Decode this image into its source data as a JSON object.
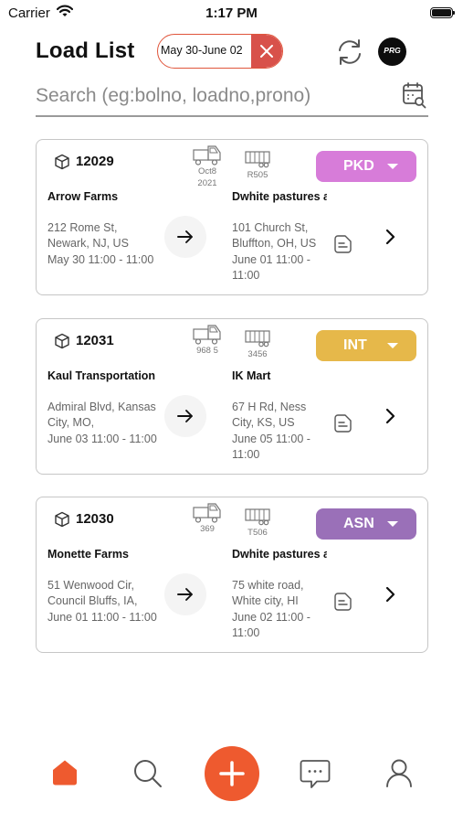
{
  "status_bar": {
    "carrier": "Carrier",
    "time": "1:17 PM"
  },
  "header": {
    "title": "Load List",
    "date_range": "May 30-June 02",
    "logo_text": "PRG"
  },
  "search": {
    "placeholder": "Search (eg:bolno, loadno,prono)",
    "value": ""
  },
  "colors": {
    "accent": "#ee5a2f",
    "pkd": "#d77cd9",
    "int": "#e6b84a",
    "asn": "#9a70b8"
  },
  "loads": [
    {
      "load_no": "12029",
      "truck": "Oct8 2021",
      "trailer": "R505",
      "status": "PKD",
      "status_color": "#d77cd9",
      "origin_name": "Arrow Farms",
      "origin_address": "212 Rome St, Newark, NJ, US",
      "origin_time": "May 30 11:00 - 11:00",
      "dest_name": "Dwhite pastures and general stor",
      "dest_address": "101 Church St, Bluffton, OH, US",
      "dest_time": "June 01 11:00 - 11:00"
    },
    {
      "load_no": "12031",
      "truck": "968 5",
      "trailer": "3456",
      "status": "INT",
      "status_color": "#e6b84a",
      "origin_name": "Kaul Transportation",
      "origin_address": "Admiral Blvd, Kansas City, MO,",
      "origin_time": "June 03 11:00 - 11:00",
      "dest_name": "IK Mart",
      "dest_address": "67 H Rd, Ness City, KS, US",
      "dest_time": "June 05 11:00 - 11:00"
    },
    {
      "load_no": "12030",
      "truck": "369",
      "trailer": "T506",
      "status": "ASN",
      "status_color": "#9a70b8",
      "origin_name": "Monette Farms",
      "origin_address": "51 Wenwood Cir, Council Bluffs, IA,",
      "origin_time": "June 01 11:00 - 11:00",
      "dest_name": "Dwhite pastures and general stor",
      "dest_address": "75 white road, White city, HI",
      "dest_time": "June 02 11:00 - 11:00"
    }
  ],
  "tab_bar": {
    "items": [
      {
        "name": "home",
        "icon": "home-icon",
        "active": true
      },
      {
        "name": "search",
        "icon": "search-icon",
        "active": false
      },
      {
        "name": "add",
        "icon": "plus-icon",
        "active": false
      },
      {
        "name": "chat",
        "icon": "chat-icon",
        "active": false
      },
      {
        "name": "profile",
        "icon": "user-icon",
        "active": false
      }
    ]
  }
}
